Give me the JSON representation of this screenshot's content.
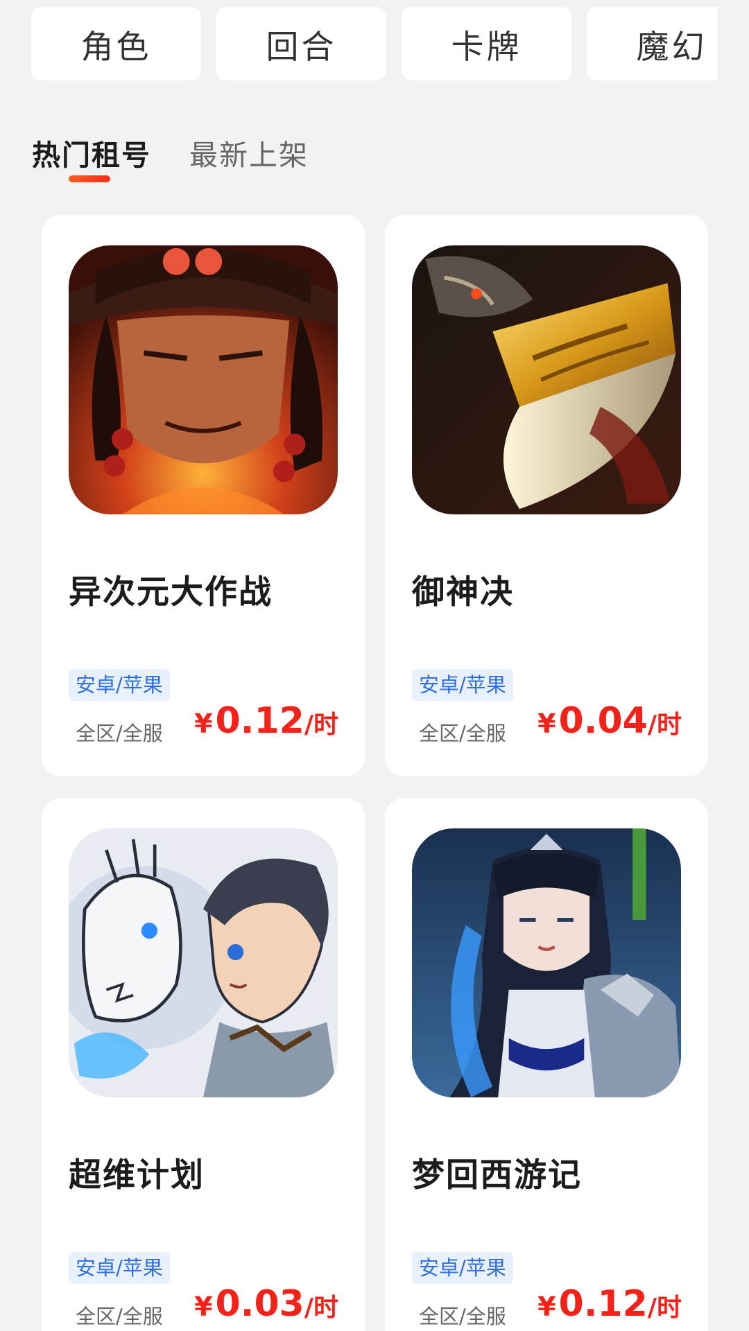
{
  "categories": [
    "角色",
    "回合",
    "卡牌",
    "魔幻"
  ],
  "tabs": [
    {
      "label": "热门租号",
      "active": true
    },
    {
      "label": "最新上架",
      "active": false
    }
  ],
  "colors": {
    "accent": "#f5221a",
    "tag_bg": "#e9f1ff",
    "tag_text": "#2f6fe0",
    "background": "#f2f2f2"
  },
  "games": [
    {
      "title": "异次元大作战",
      "platform": "安卓/苹果",
      "server": "全区/全服",
      "currency": "¥",
      "price": "0.12",
      "unit": "/时",
      "icon": "pirate-hero-art-icon"
    },
    {
      "title": "御神决",
      "platform": "安卓/苹果",
      "server": "全区/全服",
      "currency": "¥",
      "price": "0.04",
      "unit": "/时",
      "icon": "dragon-blade-art-icon"
    },
    {
      "title": "超维计划",
      "platform": "安卓/苹果",
      "server": "全区/全服",
      "currency": "¥",
      "price": "0.03",
      "unit": "/时",
      "icon": "boy-and-white-dragon-art-icon"
    },
    {
      "title": "梦回西游记",
      "platform": "安卓/苹果",
      "server": "全区/全服",
      "currency": "¥",
      "price": "0.12",
      "unit": "/时",
      "icon": "blue-hair-swordswoman-art-icon"
    }
  ]
}
